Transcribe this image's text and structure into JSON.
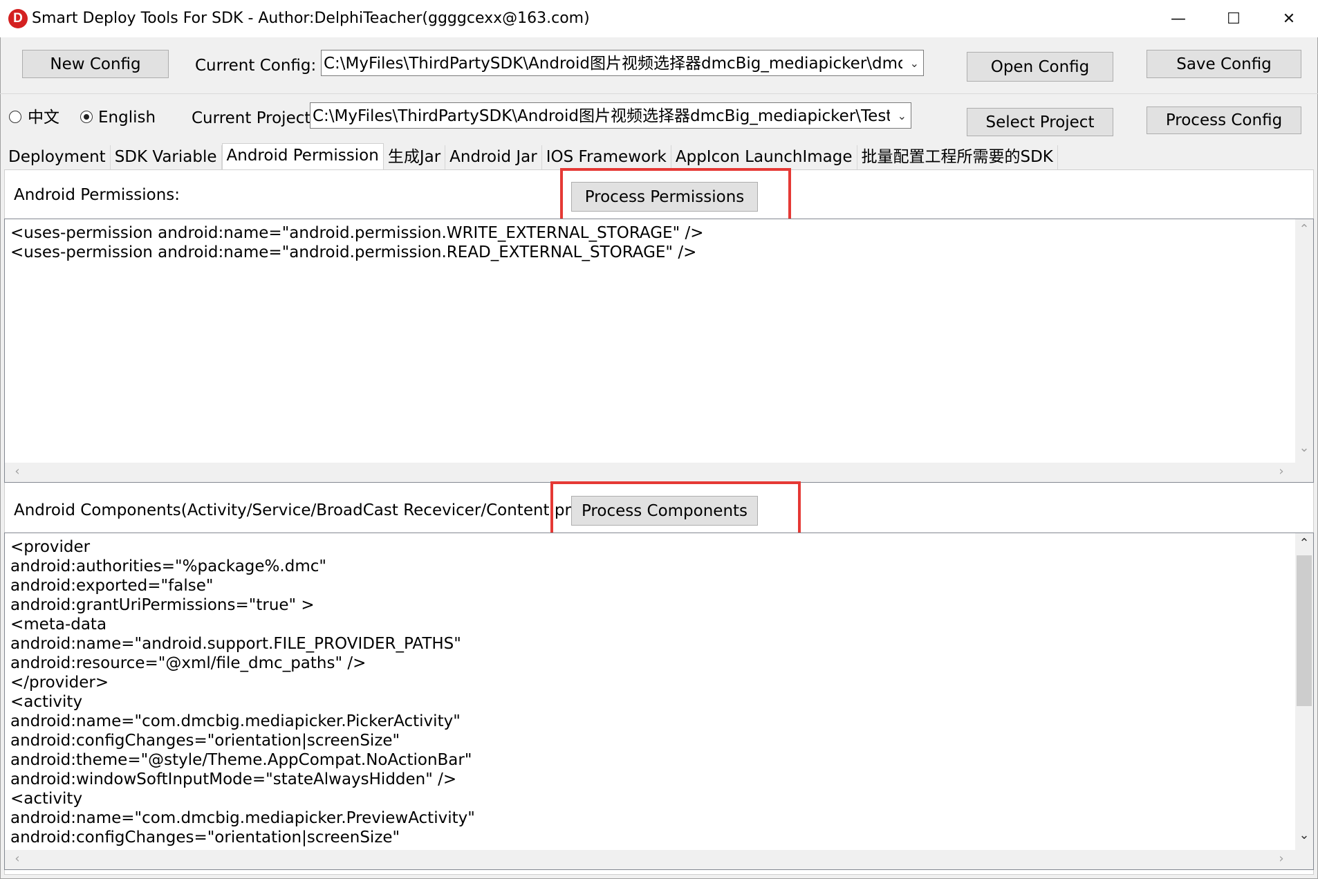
{
  "window": {
    "title": "Smart Deploy Tools For SDK - Author:DelphiTeacher(ggggcexx@163.com)",
    "logo_letter": "D",
    "minimize": "—",
    "maximize": "☐",
    "close": "✕"
  },
  "toolbar": {
    "new_config": "New Config",
    "current_config_label": "Current Config:",
    "current_config_value": "C:\\MyFiles\\ThirdPartySDK\\Android图片视频选择器dmcBig_mediapicker\\dmcBig_Me",
    "open_config": "Open Config",
    "save_config": "Save Config",
    "lang_chinese": "中文",
    "lang_english": "English",
    "selected_language": "English",
    "current_project_label": "Current Project:",
    "current_project_value": "C:\\MyFiles\\ThirdPartySDK\\Android图片视频选择器dmcBig_mediapicker\\TestMediaP",
    "select_project": "Select Project",
    "process_config": "Process Config"
  },
  "tabs": [
    {
      "label": "Deployment",
      "active": false
    },
    {
      "label": "SDK Variable",
      "active": false
    },
    {
      "label": "Android Permission",
      "active": true
    },
    {
      "label": "生成Jar",
      "active": false
    },
    {
      "label": "Android Jar",
      "active": false
    },
    {
      "label": "IOS Framework",
      "active": false
    },
    {
      "label": "AppIcon LaunchImage",
      "active": false
    },
    {
      "label": "批量配置工程所需要的SDK",
      "active": false
    }
  ],
  "permissions": {
    "label": "Android Permissions:",
    "button": "Process Permissions",
    "text": "<uses-permission android:name=\"android.permission.WRITE_EXTERNAL_STORAGE\" />\n<uses-permission android:name=\"android.permission.READ_EXTERNAL_STORAGE\" />"
  },
  "components": {
    "label": "Android Components(Activity/Service/BroadCast Recevicer/Content provider)",
    "button": "Process Components",
    "text": "<provider\nandroid:authorities=\"%package%.dmc\"\nandroid:exported=\"false\"\nandroid:grantUriPermissions=\"true\" >\n<meta-data\nandroid:name=\"android.support.FILE_PROVIDER_PATHS\"\nandroid:resource=\"@xml/file_dmc_paths\" />\n</provider>\n<activity\nandroid:name=\"com.dmcbig.mediapicker.PickerActivity\"\nandroid:configChanges=\"orientation|screenSize\"\nandroid:theme=\"@style/Theme.AppCompat.NoActionBar\"\nandroid:windowSoftInputMode=\"stateAlwaysHidden\" />\n<activity\nandroid:name=\"com.dmcbig.mediapicker.PreviewActivity\"\nandroid:configChanges=\"orientation|screenSize\""
  },
  "icons": {
    "up": "⌃",
    "down": "⌄",
    "left": "‹",
    "right": "›",
    "dropdown": "⌄"
  },
  "colors": {
    "highlight": "#e53935",
    "logo": "#d42121"
  }
}
